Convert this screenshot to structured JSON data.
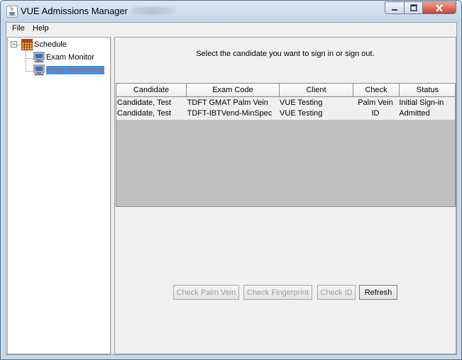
{
  "window": {
    "title": "VUE Admissions Manager"
  },
  "menu": {
    "file": "File",
    "help": "Help"
  },
  "tree": {
    "root": "Schedule",
    "children": [
      {
        "label": "Exam Monitor",
        "selected": false
      },
      {
        "label": "Entry Monitoring",
        "selected": true
      }
    ],
    "selection_color": "#3399ff",
    "selected_text_color": "#e05a1a"
  },
  "instruction": "Select the candidate you want to sign in or sign out.",
  "table": {
    "columns": [
      "Candidate",
      "Exam Code",
      "Client",
      "Check",
      "Status"
    ],
    "rows": [
      [
        "Candidate, Test",
        "TDFT GMAT Palm Vein",
        "VUE Testing",
        "Palm Vein",
        "Initial Sign-in"
      ],
      [
        "Candidate, Test",
        "TDFT-IBTVend-MinSpec",
        "VUE Testing",
        "ID",
        "Admitted"
      ]
    ]
  },
  "buttons": {
    "check_palm_vein": "Check Palm Vein",
    "check_fingerprint": "Check Fingerprint",
    "check_id": "Check ID",
    "refresh": "Refresh"
  },
  "icons": {
    "app": "java-cup-icon",
    "schedule": "grid-icon",
    "monitor": "computer-monitor-icon"
  }
}
